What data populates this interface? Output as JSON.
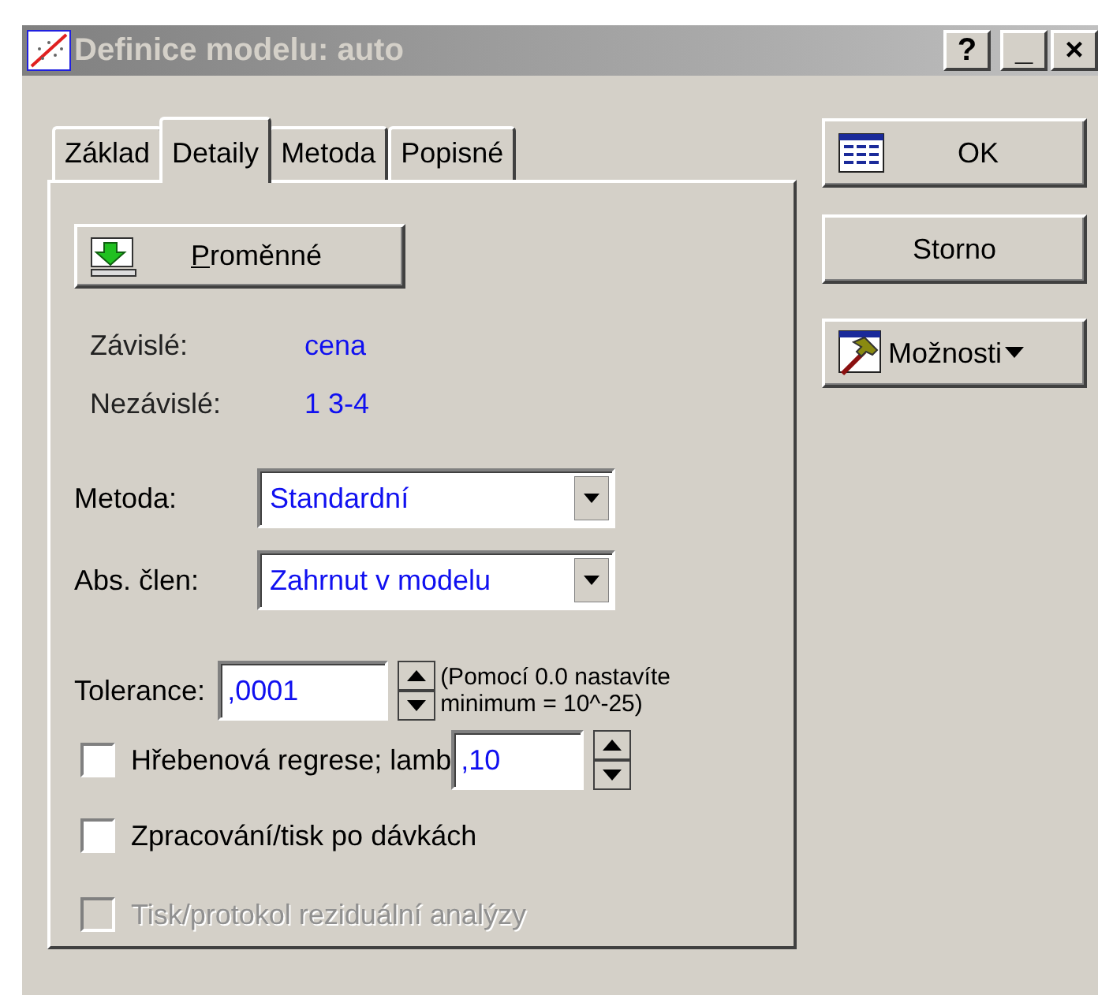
{
  "window": {
    "title": "Definice modelu: auto",
    "title_buttons": [
      "?",
      "_",
      "×"
    ]
  },
  "tabs": [
    {
      "label": "Základ",
      "selected": false
    },
    {
      "label": "Detaily",
      "selected": true
    },
    {
      "label": "Metoda",
      "selected": false
    },
    {
      "label": "Popisné",
      "selected": false
    }
  ],
  "variables_button": {
    "label": "Proměnné",
    "underline_first": true
  },
  "variables": [
    {
      "label": "Závislé:",
      "value": "cena"
    },
    {
      "label": "Nezávislé:",
      "value": "1 3-4"
    }
  ],
  "dropdowns": [
    {
      "label": "Metoda:",
      "value": "Standardní"
    },
    {
      "label": "Abs. člen:",
      "value": "Zahrnut v modelu"
    }
  ],
  "tolerance": {
    "label": "Tolerance:",
    "value": ",0001",
    "hint": [
      "(Pomocí 0.0 nastavíte",
      "minimum = 10^-25)"
    ]
  },
  "options": [
    {
      "kind": "spin",
      "label": "Hřebenová regrese; lamb",
      "value": ",10",
      "checked": false,
      "disabled": false
    },
    {
      "kind": "plain",
      "label": "Zpracování/tisk po dávkách",
      "checked": false,
      "disabled": false
    },
    {
      "kind": "plain",
      "label": "Tisk/protokol reziduální analýzy",
      "checked": false,
      "disabled": true
    }
  ],
  "buttons": [
    {
      "kind": "table",
      "label": "OK"
    },
    {
      "kind": "plain",
      "label": "Storno"
    },
    {
      "kind": "hammer",
      "label": "Možnosti",
      "dropdown": true
    }
  ]
}
